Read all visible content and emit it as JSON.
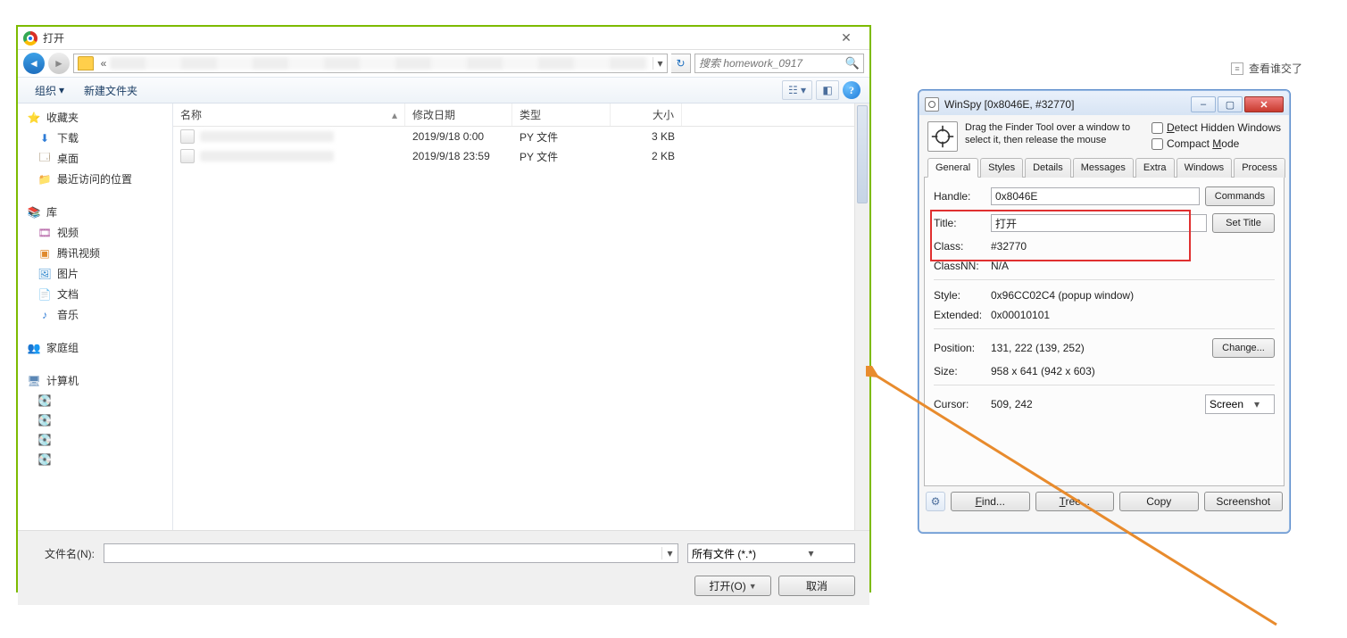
{
  "page_link": "查看谁交了",
  "open_dialog": {
    "title": "打开",
    "search_placeholder": "搜索 homework_0917",
    "toolbar": {
      "organize": "组织",
      "new_folder": "新建文件夹"
    },
    "sidebar": {
      "favorites": "收藏夹",
      "downloads": "下载",
      "desktop": "桌面",
      "recent": "最近访问的位置",
      "libraries": "库",
      "videos": "视频",
      "tencent_video": "腾讯视频",
      "pictures": "图片",
      "documents": "文档",
      "music": "音乐",
      "homegroup": "家庭组",
      "computer": "计算机"
    },
    "columns": {
      "name": "名称",
      "date": "修改日期",
      "type": "类型",
      "size": "大小"
    },
    "rows": [
      {
        "date": "2019/9/18 0:00",
        "type": "PY 文件",
        "size": "3 KB"
      },
      {
        "date": "2019/9/18 23:59",
        "type": "PY 文件",
        "size": "2 KB"
      }
    ],
    "filename_label": "文件名(N):",
    "filter": "所有文件 (*.*)",
    "open_btn": "打开(O)",
    "cancel_btn": "取消"
  },
  "winspy": {
    "title": "WinSpy [0x8046E, #32770]",
    "finder_text": "Drag the Finder Tool over a window to select it, then release the mouse",
    "check_hidden_first": "D",
    "check_hidden_rest": "etect Hidden Windows",
    "check_compact_first": "Compact ",
    "check_compact_letter": "M",
    "check_compact_rest": "ode",
    "tabs": [
      "General",
      "Styles",
      "Details",
      "Messages",
      "Extra",
      "Windows",
      "Process"
    ],
    "fields": {
      "handle_label": "Handle:",
      "handle_value": "0x8046E",
      "commands_btn": "Commands",
      "title_label": "Title:",
      "title_value": "打开",
      "settitle_btn": "Set Title",
      "class_label": "Class:",
      "class_value": "#32770",
      "classnn_label": "ClassNN:",
      "classnn_value": "N/A",
      "style_label": "Style:",
      "style_value": "0x96CC02C4 (popup window)",
      "extended_label": "Extended:",
      "extended_value": "0x00010101",
      "position_label": "Position:",
      "position_value": "131, 222 (139, 252)",
      "change_btn": "Change...",
      "size_label": "Size:",
      "size_value": "958 x 641 (942 x 603)",
      "cursor_label": "Cursor:",
      "cursor_value": "509, 242",
      "cursor_mode": "Screen"
    },
    "bottom": {
      "find": "Find...",
      "tree": "Tree...",
      "copy": "Copy",
      "screenshot": "Screenshot"
    }
  }
}
